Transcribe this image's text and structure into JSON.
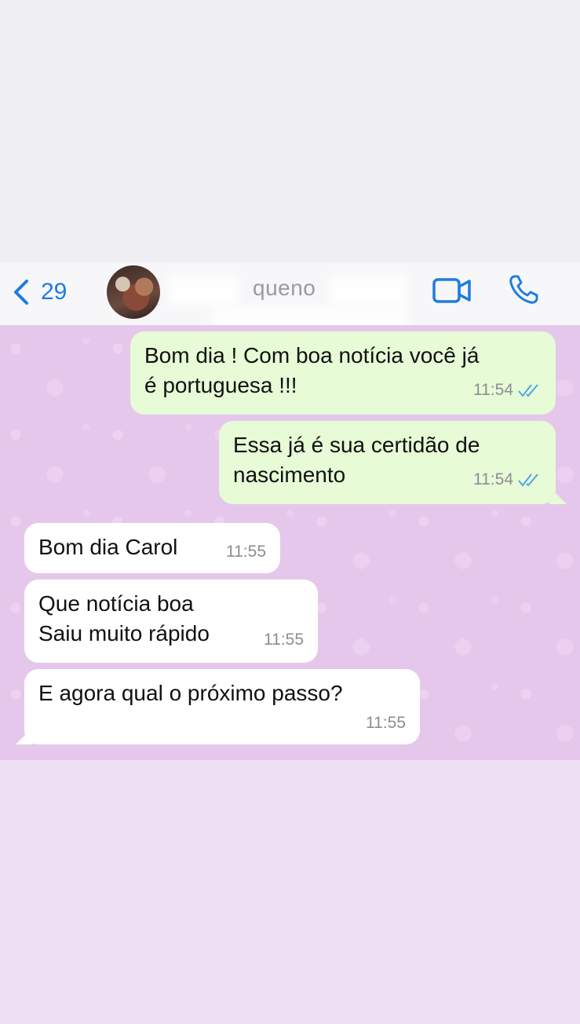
{
  "header": {
    "back_count": "29",
    "contact_name_visible": "queno"
  },
  "messages": [
    {
      "direction": "out",
      "text": "Bom dia ! Com boa notícia você já\né portuguesa !!!",
      "time": "11:54",
      "status": "read"
    },
    {
      "direction": "out",
      "text": "Essa já é sua certidão de\nnascimento",
      "time": "11:54",
      "status": "read"
    },
    {
      "direction": "in",
      "text": "Bom dia Carol",
      "time": "11:55"
    },
    {
      "direction": "in",
      "text": "Que notícia boa\nSaiu muito rápido",
      "time": "11:55"
    },
    {
      "direction": "in",
      "text": "E agora qual o próximo passo?",
      "time": "11:55"
    }
  ],
  "colors": {
    "accent": "#1f7ce0",
    "outgoing_bubble": "#e6fbd6",
    "incoming_bubble": "#ffffff",
    "chat_background": "#e6c7ec",
    "read_ticks": "#4fa6e6"
  },
  "icons": [
    "back-chevron-icon",
    "video-call-icon",
    "phone-call-icon",
    "read-ticks-icon"
  ]
}
